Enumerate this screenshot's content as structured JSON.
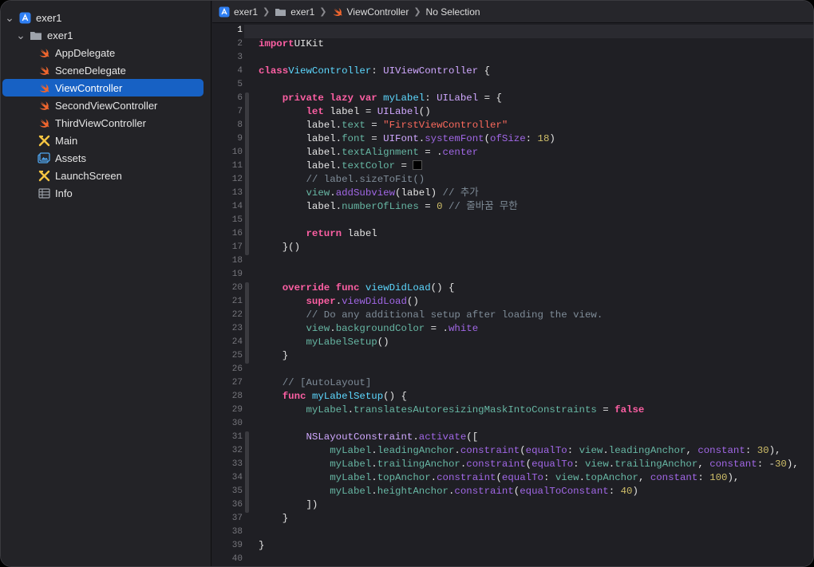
{
  "sidebar": {
    "items": [
      {
        "label": "exer1",
        "icon": "project-icon",
        "level": 0,
        "expanded": true
      },
      {
        "label": "exer1",
        "icon": "folder-icon",
        "level": 1,
        "expanded": true
      },
      {
        "label": "AppDelegate",
        "icon": "swift-icon",
        "level": 2
      },
      {
        "label": "SceneDelegate",
        "icon": "swift-icon",
        "level": 2
      },
      {
        "label": "ViewController",
        "icon": "swift-icon",
        "level": 2,
        "selected": true
      },
      {
        "label": "SecondViewController",
        "icon": "swift-icon",
        "level": 2
      },
      {
        "label": "ThirdViewController",
        "icon": "swift-icon",
        "level": 2
      },
      {
        "label": "Main",
        "icon": "storyboard-icon",
        "level": 2
      },
      {
        "label": "Assets",
        "icon": "assets-icon",
        "level": 2
      },
      {
        "label": "LaunchScreen",
        "icon": "storyboard-icon",
        "level": 2
      },
      {
        "label": "Info",
        "icon": "plist-icon",
        "level": 2
      }
    ]
  },
  "jumpbar": {
    "project": "exer1",
    "group": "exer1",
    "file": "ViewController",
    "selection": "No Selection"
  },
  "editor": {
    "current_line": 1,
    "line_numbers": [
      "1",
      "2",
      "3",
      "4",
      "5",
      "6",
      "7",
      "8",
      "9",
      "10",
      "11",
      "12",
      "13",
      "14",
      "15",
      "16",
      "17",
      "18",
      "19",
      "20",
      "21",
      "22",
      "23",
      "24",
      "25",
      "26",
      "27",
      "28",
      "29",
      "30",
      "31",
      "32",
      "33",
      "34",
      "35",
      "36",
      "37",
      "38",
      "39",
      "40"
    ],
    "code_lines": [
      [],
      [
        [
          "kw",
          "import"
        ],
        [
          "",
          "UIKit"
        ]
      ],
      [],
      [
        [
          "kw",
          "class"
        ],
        [
          "",
          ""
        ],
        [
          "dt",
          "ViewController"
        ],
        [
          "",
          ": "
        ],
        [
          "ty",
          "UIViewController"
        ],
        [
          "",
          " {"
        ]
      ],
      [],
      [
        [
          "",
          "    "
        ],
        [
          "kw",
          "private lazy var"
        ],
        [
          "",
          " "
        ],
        [
          "dt",
          "myLabel"
        ],
        [
          "",
          ": "
        ],
        [
          "ty",
          "UILabel"
        ],
        [
          "",
          " = {"
        ]
      ],
      [
        [
          "",
          "        "
        ],
        [
          "kw",
          "let"
        ],
        [
          "",
          " label = "
        ],
        [
          "ty",
          "UILabel"
        ],
        [
          "",
          "()"
        ]
      ],
      [
        [
          "",
          "        label."
        ],
        [
          "pr",
          "text"
        ],
        [
          "",
          " = "
        ],
        [
          "st",
          "\"FirstViewController\""
        ]
      ],
      [
        [
          "",
          "        label."
        ],
        [
          "pr",
          "font"
        ],
        [
          "",
          " = "
        ],
        [
          "ty",
          "UIFont"
        ],
        [
          "",
          "."
        ],
        [
          "fn",
          "systemFont"
        ],
        [
          "",
          "("
        ],
        [
          "fn",
          "ofSize"
        ],
        [
          "",
          ": "
        ],
        [
          "nm",
          "18"
        ],
        [
          "",
          ")"
        ]
      ],
      [
        [
          "",
          "        label."
        ],
        [
          "pr",
          "textAlignment"
        ],
        [
          "",
          " = ."
        ],
        [
          "fn",
          "center"
        ]
      ],
      [
        [
          "",
          "        label."
        ],
        [
          "pr",
          "textColor"
        ],
        [
          "",
          " = "
        ],
        [
          "sw",
          ""
        ]
      ],
      [
        [
          "",
          "        "
        ],
        [
          "cm",
          "// label.sizeToFit()"
        ]
      ],
      [
        [
          "",
          "        "
        ],
        [
          "pr",
          "view"
        ],
        [
          "",
          "."
        ],
        [
          "fn",
          "addSubview"
        ],
        [
          "",
          "(label) "
        ],
        [
          "cm",
          "// 추가"
        ]
      ],
      [
        [
          "",
          "        label."
        ],
        [
          "pr",
          "numberOfLines"
        ],
        [
          "",
          " = "
        ],
        [
          "nm",
          "0"
        ],
        [
          "",
          " "
        ],
        [
          "cm",
          "// 줄바꿈 무한"
        ]
      ],
      [],
      [
        [
          "",
          "        "
        ],
        [
          "kw",
          "return"
        ],
        [
          "",
          " label"
        ]
      ],
      [
        [
          "",
          "    }()"
        ]
      ],
      [],
      [],
      [
        [
          "",
          "    "
        ],
        [
          "kw",
          "override func"
        ],
        [
          "",
          " "
        ],
        [
          "dt",
          "viewDidLoad"
        ],
        [
          "",
          "() {"
        ]
      ],
      [
        [
          "",
          "        "
        ],
        [
          "kw",
          "super"
        ],
        [
          "",
          "."
        ],
        [
          "fn",
          "viewDidLoad"
        ],
        [
          "",
          "()"
        ]
      ],
      [
        [
          "",
          "        "
        ],
        [
          "cm",
          "// Do any additional setup after loading the view."
        ]
      ],
      [
        [
          "",
          "        "
        ],
        [
          "pr",
          "view"
        ],
        [
          "",
          "."
        ],
        [
          "pr",
          "backgroundColor"
        ],
        [
          "",
          " = ."
        ],
        [
          "fn",
          "white"
        ]
      ],
      [
        [
          "",
          "        "
        ],
        [
          "pr",
          "myLabelSetup"
        ],
        [
          "",
          "()"
        ]
      ],
      [
        [
          "",
          "    }"
        ]
      ],
      [],
      [
        [
          "",
          "    "
        ],
        [
          "cm",
          "// [AutoLayout]"
        ]
      ],
      [
        [
          "",
          "    "
        ],
        [
          "kw",
          "func"
        ],
        [
          "",
          " "
        ],
        [
          "dt",
          "myLabelSetup"
        ],
        [
          "",
          "() {"
        ]
      ],
      [
        [
          "",
          "        "
        ],
        [
          "pr",
          "myLabel"
        ],
        [
          "",
          "."
        ],
        [
          "pr",
          "translatesAutoresizingMaskIntoConstraints"
        ],
        [
          "",
          " = "
        ],
        [
          "kw",
          "false"
        ]
      ],
      [],
      [
        [
          "",
          "        "
        ],
        [
          "ty",
          "NSLayoutConstraint"
        ],
        [
          "",
          "."
        ],
        [
          "fn",
          "activate"
        ],
        [
          "",
          "(["
        ]
      ],
      [
        [
          "",
          "            "
        ],
        [
          "pr",
          "myLabel"
        ],
        [
          "",
          "."
        ],
        [
          "pr",
          "leadingAnchor"
        ],
        [
          "",
          "."
        ],
        [
          "fn",
          "constraint"
        ],
        [
          "",
          "("
        ],
        [
          "fn",
          "equalTo"
        ],
        [
          "",
          ": "
        ],
        [
          "pr",
          "view"
        ],
        [
          "",
          "."
        ],
        [
          "pr",
          "leadingAnchor"
        ],
        [
          "",
          ", "
        ],
        [
          "fn",
          "constant"
        ],
        [
          "",
          ": "
        ],
        [
          "nm",
          "30"
        ],
        [
          "",
          "),"
        ]
      ],
      [
        [
          "",
          "            "
        ],
        [
          "pr",
          "myLabel"
        ],
        [
          "",
          "."
        ],
        [
          "pr",
          "trailingAnchor"
        ],
        [
          "",
          "."
        ],
        [
          "fn",
          "constraint"
        ],
        [
          "",
          "("
        ],
        [
          "fn",
          "equalTo"
        ],
        [
          "",
          ": "
        ],
        [
          "pr",
          "view"
        ],
        [
          "",
          "."
        ],
        [
          "pr",
          "trailingAnchor"
        ],
        [
          "",
          ", "
        ],
        [
          "fn",
          "constant"
        ],
        [
          "",
          ": -"
        ],
        [
          "nm",
          "30"
        ],
        [
          "",
          "),"
        ]
      ],
      [
        [
          "",
          "            "
        ],
        [
          "pr",
          "myLabel"
        ],
        [
          "",
          "."
        ],
        [
          "pr",
          "topAnchor"
        ],
        [
          "",
          "."
        ],
        [
          "fn",
          "constraint"
        ],
        [
          "",
          "("
        ],
        [
          "fn",
          "equalTo"
        ],
        [
          "",
          ": "
        ],
        [
          "pr",
          "view"
        ],
        [
          "",
          "."
        ],
        [
          "pr",
          "topAnchor"
        ],
        [
          "",
          ", "
        ],
        [
          "fn",
          "constant"
        ],
        [
          "",
          ": "
        ],
        [
          "nm",
          "100"
        ],
        [
          "",
          "),"
        ]
      ],
      [
        [
          "",
          "            "
        ],
        [
          "pr",
          "myLabel"
        ],
        [
          "",
          "."
        ],
        [
          "pr",
          "heightAnchor"
        ],
        [
          "",
          "."
        ],
        [
          "fn",
          "constraint"
        ],
        [
          "",
          "("
        ],
        [
          "fn",
          "equalToConstant"
        ],
        [
          "",
          ": "
        ],
        [
          "nm",
          "40"
        ],
        [
          "",
          ")"
        ]
      ],
      [
        [
          "",
          "        ])"
        ]
      ],
      [
        [
          "",
          "    }"
        ]
      ],
      [],
      [
        [
          "",
          "}"
        ]
      ],
      []
    ]
  },
  "colors": {
    "selection": "#1761c4",
    "keyword": "#fc5fa3",
    "declaration": "#5dd8ff",
    "type": "#d0a8ff",
    "property": "#67b7a4",
    "function": "#a167e6",
    "string": "#fc6a5d",
    "number": "#d0bf69",
    "comment": "#7f8c98"
  }
}
